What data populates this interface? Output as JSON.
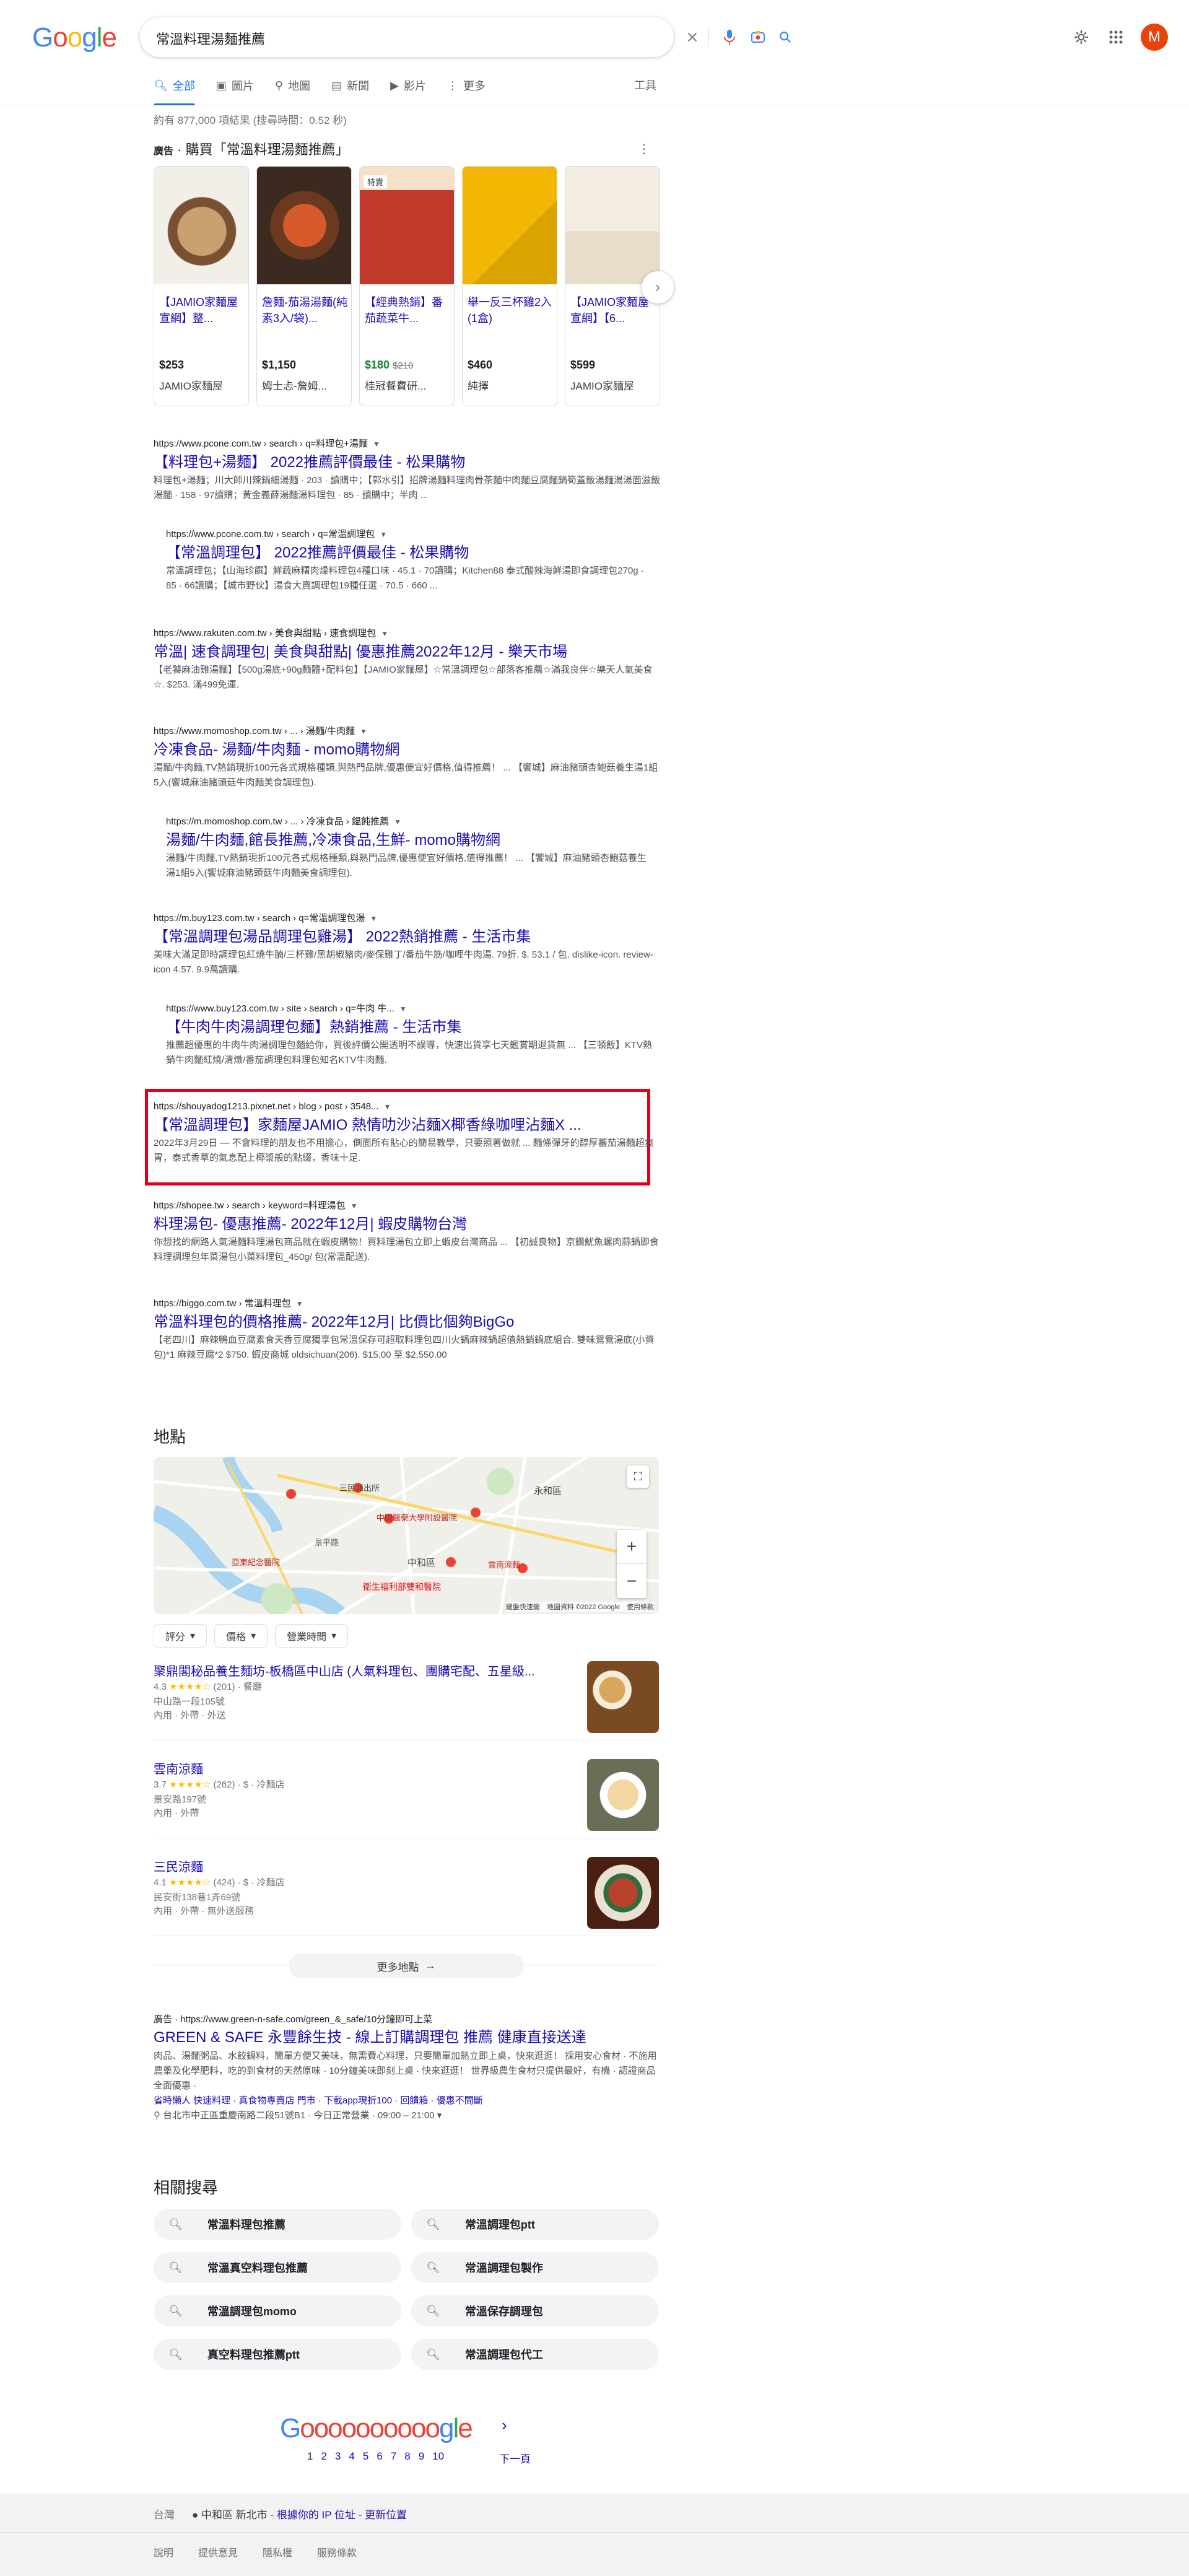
{
  "header": {
    "logo": "Google",
    "query": "常溫料理湯麵推薦",
    "avatar_letter": "M"
  },
  "tabs": [
    {
      "label": "全部",
      "icon": "search-icon"
    },
    {
      "label": "圖片",
      "icon": "image-icon"
    },
    {
      "label": "地圖",
      "icon": "map-pin-icon"
    },
    {
      "label": "新聞",
      "icon": "news-icon"
    },
    {
      "label": "影片",
      "icon": "video-icon"
    },
    {
      "label": "更多",
      "icon": "more-vert-icon"
    }
  ],
  "tools_label": "工具",
  "result_stats": "約有 877,000 項結果 (搜尋時間：0.52 秒)",
  "shopping": {
    "ad_label": "廣告",
    "title": "· 購買「常溫料理湯麵推薦」",
    "products": [
      {
        "title": "【JAMIO家麵屋宣網】整...",
        "price": "$253",
        "old_price": "",
        "seller": "JAMIO家麵屋",
        "tag": ""
      },
      {
        "title": "詹麵-茄湯湯麵(純素3入/袋)...",
        "price": "$1,150",
        "old_price": "",
        "seller": "姆士忐-詹姆...",
        "tag": ""
      },
      {
        "title": "【經典熱銷】番茄蔬菜牛...",
        "price": "$180",
        "old_price": "$210",
        "seller": "桂冠餐費研...",
        "tag": "特賣"
      },
      {
        "title": "舉一反三杯雞2入(1盒)",
        "price": "$460",
        "old_price": "",
        "seller": "純擇",
        "tag": ""
      },
      {
        "title": "【JAMIO家麵屋宣網】【6...",
        "price": "$599",
        "old_price": "",
        "seller": "JAMIO家麵屋",
        "tag": ""
      }
    ]
  },
  "results": [
    {
      "url": "https://www.pcone.com.tw › search › q=料理包+湯麵",
      "title": "【料理包+湯麵】 2022推薦評價最佳 - 松果購物",
      "snippet": [
        "料理包+湯麵；川大師川辣鍋細湯麵 · 203 · 讀購中；【郭水引】招牌湯麵料理肉骨茶麵中肉麵豆腐麵鍋筍蓋飯湯麵湯湯面滋飯湯麵 · 158 · 97讀購；黃金義薛湯麵湯料理包 · 85 · 讀購中；半肉 ..."
      ],
      "highlight": false
    },
    {
      "url": "https://www.pcone.com.tw › search › q=常溫調理包",
      "title": "【常溫調理包】 2022推薦評價最佳 - 松果購物",
      "snippet": [
        "常溫調理包；【山海珍饌】鮮蔬麻糬肉燥料理包4種口味 · 45.1 · 70讀購；Kitchen88 泰式酸辣海鮮湯即食調理包270g · 85 · 66讀購；【城市野伙】湯食大賣調理包19種任選 · 70.5 · 660 ..."
      ],
      "highlight": false
    },
    {
      "url": "https://www.rakuten.com.tw › 美食與甜點 › 速食調理包",
      "title": "常溫| 速食調理包| 美食與甜點| 優惠推薦2022年12月 - 樂天市場",
      "snippet": [
        "【老饕麻油雞湯麵】【500g湯底+90g麵體+配料包】【JAMIO家麵屋】☆常溫調理包☆部落客推薦☆滿我良伴☆樂天人氣美食☆. $253. 滿499免運."
      ],
      "highlight": false
    },
    {
      "url": "https://www.momoshop.com.tw › ... › 湯麵/牛肉麵",
      "title": "冷凍食品- 湯麵/牛肉麵 - momo購物網",
      "snippet": [
        "湯麵/牛肉麵,TV熱銷現折100元各式規格種類,與熱門品牌,優惠便宜好價格,值得推薦！ ... 【饗城】麻油豬頭杏鮑菇養生湯1組5入(饗城麻油豬頭菇牛肉麵美食調理包)."
      ],
      "highlight": false
    },
    {
      "url": "https://m.momoshop.com.tw › ... › 冷凍食品 › 饂飩推薦",
      "title": "湯麵/牛肉麵,館長推薦,冷凍食品,生鮮- momo購物網",
      "snippet": [
        "湯麵/牛肉麵,TV熱銷現折100元各式規格種類,與熱門品牌,優惠便宜好價格,值得推薦！ ... 【饗城】麻油豬頭杏鮑菇養生湯1組5入(饗城麻油豬頭菇牛肉麵美食調理包)."
      ],
      "highlight": false
    },
    {
      "url": "https://m.buy123.com.tw › search › q=常溫調理包湯",
      "title": "【常溫調理包湯品調理包雞湯】 2022熱銷推薦 - 生活市集",
      "snippet": [
        "美味大滿足即時調理包紅燒牛腩/三杯雞/黑胡椒豬肉/麥保雞丁/番茄牛筋/咖哩牛肉湯. 79折. $. 53.1 / 包. dislike-icon. review-icon 4.57. 9.9萬讀購."
      ],
      "highlight": false
    },
    {
      "url": "https://www.buy123.com.tw › site › search › q=牛肉 牛...",
      "title": "【牛肉牛肉湯調理包麵】熱銷推薦 - 生活市集",
      "snippet": [
        "推薦超優惠的牛肉牛肉湯調理包麵給你，買後評價公開透明不誤導，快速出貨享七天鑑賞期退貨無 ... 【三頓飯】KTV熱銷牛肉麵紅燒/清燉/番茄調理包料理包知名KTV牛肉麵."
      ],
      "highlight": false
    },
    {
      "url": "https://shouyadog1213.pixnet.net › blog › post › 3548...",
      "title": "【常溫調理包】家麵屋JAMIO 熱情叻沙沾麵X椰香綠咖哩沾麵X ...",
      "snippet": [
        "2022年3月29日 — 不會料理的朋友也不用擔心，側面所有貼心的簡易教學，只要照著做就 ... 麵條彈牙的醇厚蕃茄湯麵超爽胃，泰式香草的氣息配上椰漿般的點綴，香味十足."
      ],
      "highlight": true
    },
    {
      "url": "https://shopee.tw › search › keyword=料理湯包",
      "title": "料理湯包- 優惠推薦- 2022年12月| 蝦皮購物台灣",
      "snippet": [
        "你想找的網路人氣湯麵料理湯包商品就在蝦皮購物！買料理湯包立即上蝦皮台灣商品 ... 【初誠良物】京鑽魷魚螺肉蒜鍋即食料理調理包年菜湯包小菜料理包_450g/ 包(常溫配送)."
      ],
      "highlight": false
    },
    {
      "url": "https://biggo.com.tw › 常溫料理包",
      "title": "常溫料理包的價格推薦- 2022年12月| 比價比個夠BigGo",
      "snippet": [
        "【老四川】麻辣鴨血豆腐素食天香豆腐獨享包常溫保存可超取料理包四川火鍋麻辣鍋超值熱銷鍋底組合. 雙味鴛鴦湯底(小資包)*1 麻辣豆腐*2 $750. 蝦皮商城 oldsichuan(206). $15.00 至 $2,550.00"
      ],
      "highlight": false
    }
  ],
  "places": {
    "heading": "地點",
    "map_attribution": "鍵盤快速鍵　地圖資料 ©2022 Google　使用條款",
    "map_labels": [
      "三民派出所",
      "永和區",
      "中和區",
      "亞東紀念醫院",
      "中國醫藥大學附設醫院",
      "景平路",
      "雲南涼麵",
      "衛生福利部雙和醫院"
    ],
    "filters": [
      "評分",
      "價格",
      "營業時間"
    ],
    "list": [
      {
        "name": "聚鼎閣秘品養生麵坊-板橋區中山店 (人氣料理包、團購宅配、五星級...",
        "rating": "4.3",
        "stars": "★★★★☆",
        "reviews": "(201)",
        "category": "· 餐廳",
        "address": "中山路一段105號",
        "services": "內用 · 外帶 · 外送"
      },
      {
        "name": "雲南涼麵",
        "rating": "3.7",
        "stars": "★★★★☆",
        "reviews": "(262)",
        "category": "· $ · 冷麵店",
        "address": "景安路197號",
        "services": "內用 · 外帶"
      },
      {
        "name": "三民涼麵",
        "rating": "4.1",
        "stars": "★★★★☆",
        "reviews": "(424)",
        "category": "· $ · 冷麵店",
        "address": "民安街138巷1弄69號",
        "services": "內用 · 外帶 · 無外送服務"
      }
    ],
    "more_label": "更多地點"
  },
  "ad2": {
    "url": "廣告 · https://www.green-n-safe.com/green_&_safe/10分鐘即可上菜",
    "title": "GREEN & SAFE 永豐餘生技 - 線上訂購調理包 推薦 健康直接送達",
    "snippet": "肉品、湯麵粥品、水餃鍋料，簡單方便又美味，無需費心料理，只要簡單加熱立即上桌，快來逛逛！ 採用安心食材 · 不施用農藥及化學肥料，吃的到食材的天然原味 · 10分鐘美味即刻上桌 · 快來逛逛！ 世界級農生食材只提供最好，有機 · 認證商品全面優惠 ·",
    "links": "省時懶人 快速料理 · 真食物專賣店 門市 · 下載app現折100 · 回饋箱 · 優惠不間斷",
    "location": "台北市中正區重慶南路二段51號B1 · 今日正常營業 · 09:00 – 21:00 ▾"
  },
  "related": {
    "heading": "相關搜尋",
    "items": [
      "常溫料理包推薦",
      "常溫調理包ptt",
      "常溫真空料理包推薦",
      "常溫調理包製作",
      "常溫調理包momo",
      "常溫保存調理包",
      "真空料理包推薦ptt",
      "常溫調理包代工"
    ]
  },
  "pagination": {
    "logo": "Gooooooooooogle",
    "pages": [
      "1",
      "2",
      "3",
      "4",
      "5",
      "6",
      "7",
      "8",
      "9",
      "10"
    ],
    "next": "下一頁"
  },
  "footer": {
    "country": "台灣",
    "location": "● 中和區 新北市",
    "location_link1": "根據你的 IP 位址",
    "location_link2": "更新位置",
    "links": [
      "說明",
      "提供意見",
      "隱私權",
      "服務條款"
    ]
  },
  "colors": {
    "link": "#1a0dab",
    "accent": "#1a73e8",
    "highlight_box": "#e3001b",
    "emphasis": "#e8430a"
  }
}
